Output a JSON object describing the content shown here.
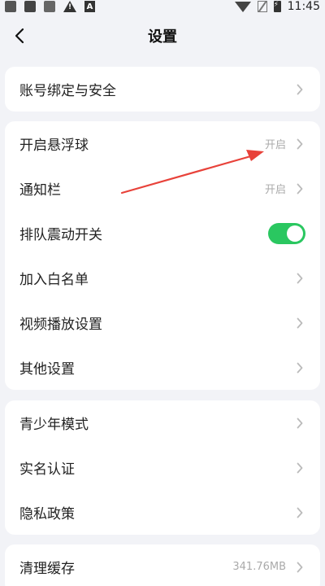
{
  "statusbar": {
    "time": "11:45"
  },
  "header": {
    "title": "设置"
  },
  "group1": [
    {
      "label": "账号绑定与安全"
    }
  ],
  "group2": [
    {
      "label": "开启悬浮球",
      "value": "开启"
    },
    {
      "label": "通知栏",
      "value": "开启"
    },
    {
      "label": "排队震动开关",
      "toggle": "on"
    },
    {
      "label": "加入白名单"
    },
    {
      "label": "视频播放设置"
    },
    {
      "label": "其他设置"
    }
  ],
  "group3": [
    {
      "label": "青少年模式"
    },
    {
      "label": "实名认证"
    },
    {
      "label": "隐私政策"
    }
  ],
  "group4": [
    {
      "label": "清理缓存",
      "value": "341.76MB"
    }
  ],
  "colors": {
    "accent": "#2ac760",
    "annotation": "#e8423a"
  }
}
